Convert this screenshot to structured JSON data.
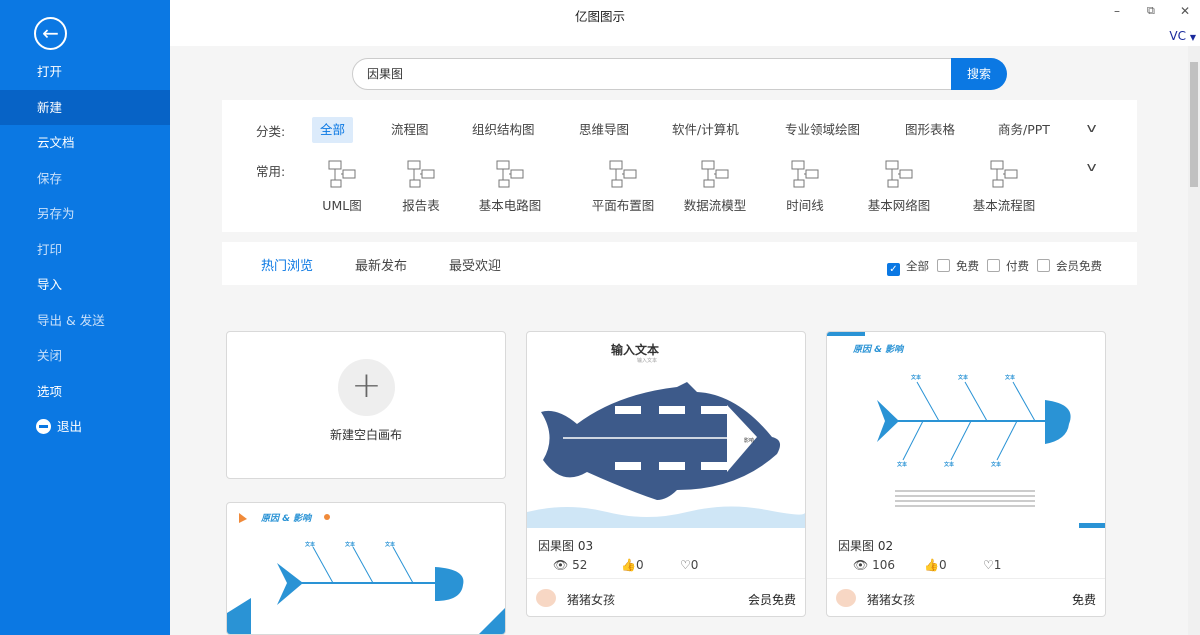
{
  "app": {
    "title": "亿图图示",
    "user": "VC",
    "window_controls": [
      "minimize",
      "restore",
      "close"
    ]
  },
  "sidebar": {
    "back_icon": "arrow-left-circle",
    "items": [
      {
        "label": "打开"
      },
      {
        "label": "新建",
        "selected": true
      },
      {
        "label": "云文档"
      },
      {
        "label": "保存",
        "disabled": true
      },
      {
        "label": "另存为",
        "disabled": true
      },
      {
        "label": "打印",
        "disabled": true
      },
      {
        "label": "导入"
      },
      {
        "label": "导出 & 发送",
        "disabled": true
      },
      {
        "label": "关闭",
        "disabled": true
      },
      {
        "label": "选项"
      },
      {
        "label": "退出"
      }
    ]
  },
  "search": {
    "value": "因果图",
    "button": "搜索"
  },
  "categories": {
    "label": "分类:",
    "items": [
      "全部",
      "流程图",
      "组织结构图",
      "思维导图",
      "软件/计算机",
      "专业领域绘图",
      "图形表格",
      "商务/PPT"
    ],
    "selected": "全部"
  },
  "common": {
    "label": "常用:",
    "items": [
      "UML图",
      "报告表",
      "基本电路图",
      "平面布置图",
      "数据流模型",
      "时间线",
      "基本网络图",
      "基本流程图"
    ]
  },
  "tabs": {
    "items": [
      "热门浏览",
      "最新发布",
      "最受欢迎"
    ],
    "selected": "热门浏览"
  },
  "filters": [
    {
      "label": "全部",
      "checked": true
    },
    {
      "label": "免费",
      "checked": false
    },
    {
      "label": "付费",
      "checked": false
    },
    {
      "label": "会员免费",
      "checked": false
    }
  ],
  "blank": {
    "label": "新建空白画布"
  },
  "cards": [
    {
      "name": "因果图 03",
      "views": "52",
      "likes": "0",
      "favorites": "0",
      "author": "猪猪女孩",
      "price": "会员免费",
      "thumb_title": "输入文本",
      "thumb_subtitle": "输入文本",
      "thumb_effect": "影响"
    },
    {
      "name": "因果图 02",
      "views": "106",
      "likes": "0",
      "favorites": "1",
      "author": "猪猪女孩",
      "price": "免费",
      "thumb_title": "原因 & 影响",
      "thumb_label": "文本"
    },
    {
      "thumb_title": "原因 & 影响",
      "thumb_label": "文本"
    }
  ],
  "colors": {
    "brand": "#0b78e3",
    "fish_dark": "#3d5a8a",
    "fish_blue": "#2a93d5"
  }
}
